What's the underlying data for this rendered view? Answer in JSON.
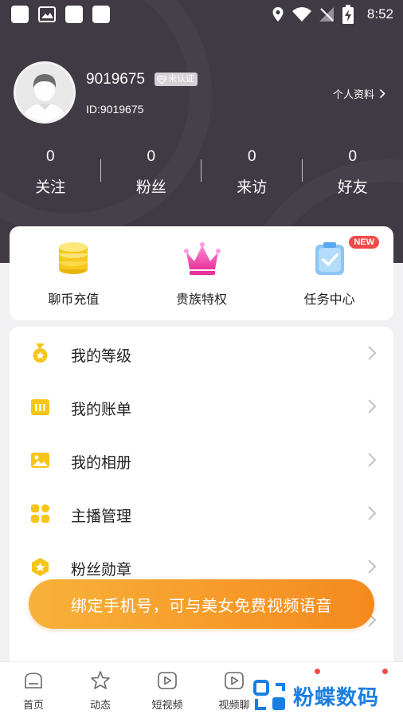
{
  "status_bar": {
    "time": "8:52"
  },
  "profile": {
    "username": "9019675",
    "verify_badge": "未认证",
    "id_text": "ID:9019675",
    "profile_link": "个人资料"
  },
  "stats": [
    {
      "value": "0",
      "label": "关注"
    },
    {
      "value": "0",
      "label": "粉丝"
    },
    {
      "value": "0",
      "label": "来访"
    },
    {
      "value": "0",
      "label": "好友"
    }
  ],
  "quick_actions": [
    {
      "label": "聊币充值",
      "icon": "coin-stack-icon"
    },
    {
      "label": "贵族特权",
      "icon": "crown-icon"
    },
    {
      "label": "任务中心",
      "icon": "task-clipboard-icon",
      "badge": "NEW"
    }
  ],
  "menu": [
    {
      "label": "我的等级",
      "icon": "medal-icon"
    },
    {
      "label": "我的账单",
      "icon": "bill-icon"
    },
    {
      "label": "我的相册",
      "icon": "photo-icon"
    },
    {
      "label": "主播管理",
      "icon": "grid-icon"
    },
    {
      "label": "粉丝勋章",
      "icon": "star-badge-icon"
    }
  ],
  "toast": "绑定手机号，可与美女免费视频语音",
  "tabs": [
    {
      "label": "首页",
      "icon": "home-icon"
    },
    {
      "label": "动态",
      "icon": "star-icon"
    },
    {
      "label": "短视频",
      "icon": "play-icon"
    },
    {
      "label": "视频聊",
      "icon": "video-icon"
    }
  ],
  "watermark": "粉蝶数码",
  "colors": {
    "header_bg": "#3f3a43",
    "accent": "#f7b23a",
    "new_badge": "#f04a4a",
    "icon_yellow": "#f5c518"
  }
}
